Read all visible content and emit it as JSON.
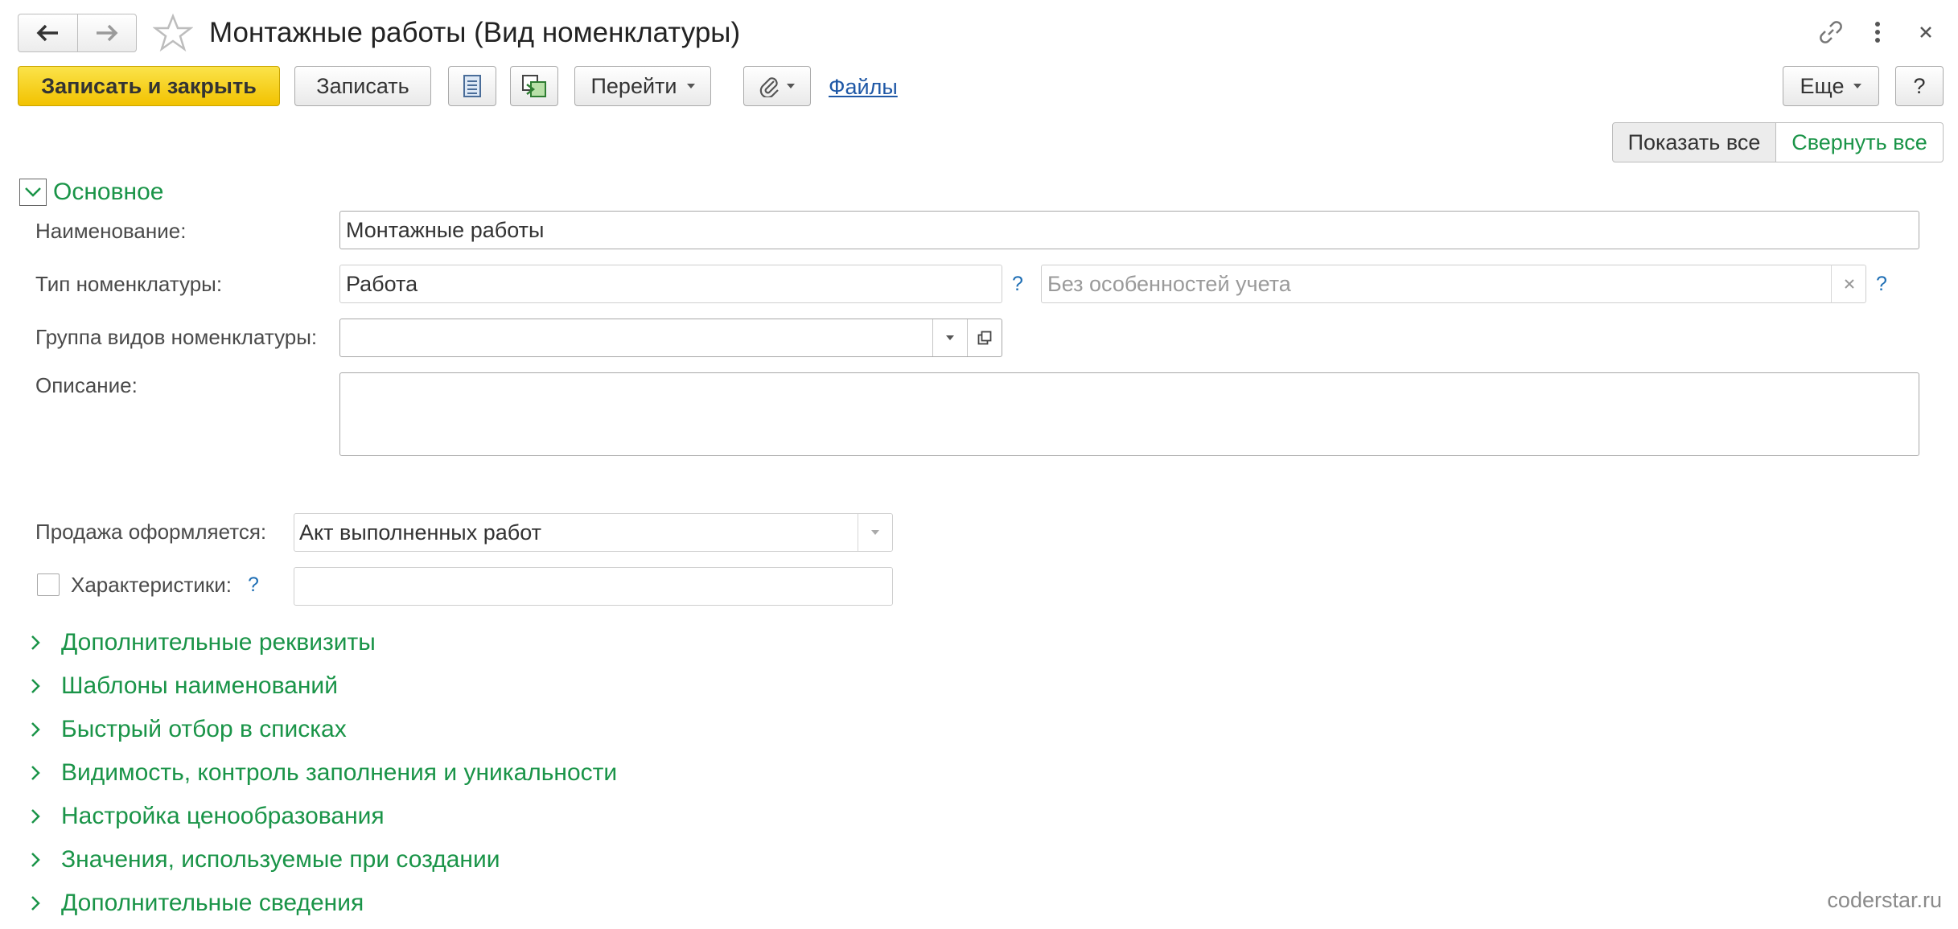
{
  "window": {
    "title": "Монтажные работы (Вид номенклатуры)",
    "icons": [
      "back-arrow-icon",
      "forward-arrow-icon",
      "star-icon",
      "link-icon",
      "more-vertical-icon",
      "close-icon"
    ]
  },
  "toolbar": {
    "save_close_label": "Записать и закрыть",
    "save_label": "Записать",
    "goto_label": "Перейти",
    "files_link": "Файлы",
    "more_label": "Еще",
    "help_label": "?"
  },
  "view_toggle": {
    "show_all": "Показать все",
    "collapse_all": "Свернуть все"
  },
  "main_section": {
    "title": "Основное",
    "name_label": "Наименование:",
    "name_value": "Монтажные работы",
    "type_label": "Тип номенклатуры:",
    "type_value": "Работа",
    "type_help": "?",
    "accounting_placeholder": "Без особенностей учета",
    "accounting_help": "?",
    "group_label": "Группа видов номенклатуры:",
    "group_value": "",
    "description_label": "Описание:",
    "description_value": "",
    "sale_label": "Продажа оформляется:",
    "sale_value": "Акт выполненных работ",
    "characteristics_label": "Характеристики:",
    "characteristics_help": "?",
    "characteristics_checked": false,
    "characteristics_value": ""
  },
  "collapsed_sections": [
    "Дополнительные реквизиты",
    "Шаблоны наименований",
    "Быстрый отбор в списках",
    "Видимость, контроль заполнения и уникальности",
    "Настройка ценообразования",
    "Значения, используемые при создании",
    "Дополнительные сведения"
  ],
  "watermark": "coderstar.ru",
  "colors": {
    "primary_button": "#f5cc14",
    "section_green": "#1a9448",
    "link_blue": "#1f58a6"
  }
}
